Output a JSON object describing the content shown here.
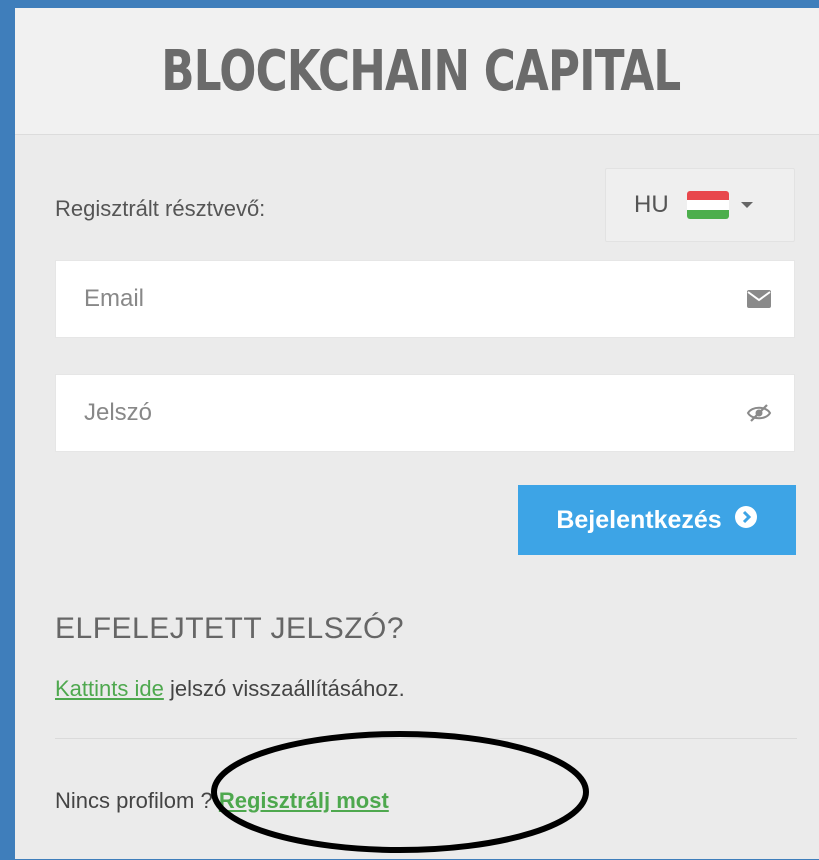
{
  "brand": {
    "title": "BLOCKCHAIN CAPITAL"
  },
  "login": {
    "registered_label": "Regisztrált résztvevő:",
    "language": {
      "code": "HU"
    },
    "email": {
      "placeholder": "Email",
      "value": ""
    },
    "password": {
      "placeholder": "Jelszó",
      "value": ""
    },
    "submit_label": "Bejelentkezés"
  },
  "forgot": {
    "heading": "ELFELEJTETT JELSZÓ?",
    "link_text": "Kattints ide",
    "rest_text": " jelszó visszaállításához."
  },
  "register": {
    "prompt": "Nincs profilom ? ",
    "link_text": "Regisztrálj most"
  },
  "colors": {
    "accent_blue": "#3da4e6",
    "link_green": "#4ea84e",
    "frame_blue": "#3f7ebb"
  },
  "icons": [
    "envelope-icon",
    "eye-slash-icon",
    "chevron-circle-right-icon",
    "hungary-flag-icon",
    "caret-down-icon"
  ]
}
